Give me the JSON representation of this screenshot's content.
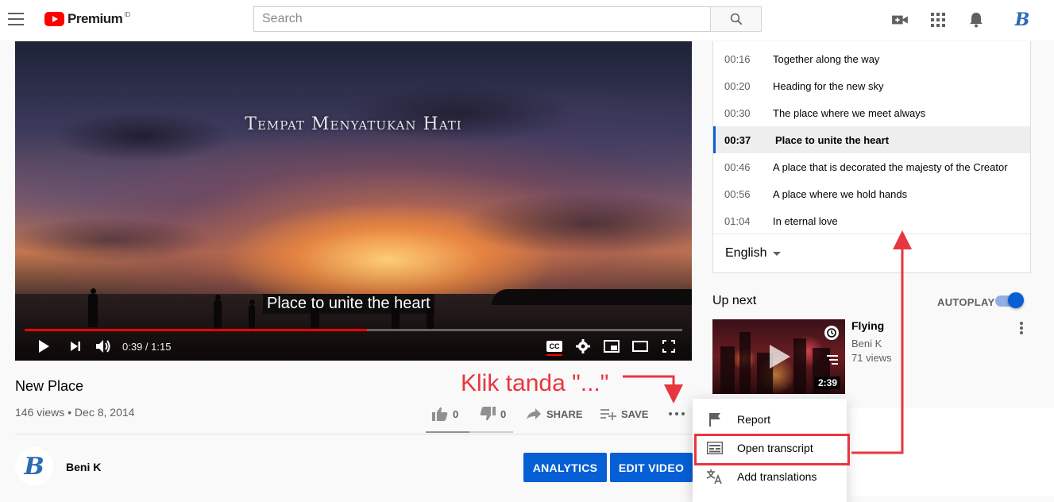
{
  "header": {
    "logo_text": "Premium",
    "logo_region": "ID",
    "search_placeholder": "Search",
    "avatar_letter": "B"
  },
  "player": {
    "overlay_title": "Tempat Menyatukan Hati",
    "caption": "Place to unite the heart",
    "time_display": "0:39 / 1:15",
    "progress_fraction": 0.52
  },
  "video": {
    "title": "New Place",
    "meta": "146 views • Dec 8, 2014",
    "likes": "0",
    "dislikes": "0",
    "share_label": "SHARE",
    "save_label": "SAVE"
  },
  "channel": {
    "name": "Beni K",
    "avatar_letter": "B",
    "analytics_label": "ANALYTICS",
    "edit_label": "EDIT VIDEO"
  },
  "transcript": {
    "rows": [
      {
        "time": "00:16",
        "text": "Together along the way"
      },
      {
        "time": "00:20",
        "text": "Heading for the new sky"
      },
      {
        "time": "00:30",
        "text": "The place where we meet always"
      },
      {
        "time": "00:37",
        "text": "Place to unite the heart"
      },
      {
        "time": "00:46",
        "text": "A place that is decorated the majesty of the Creator"
      },
      {
        "time": "00:56",
        "text": "A place where we hold hands"
      },
      {
        "time": "01:04",
        "text": "In eternal love"
      }
    ],
    "active_index": 3,
    "language": "English"
  },
  "up_next": {
    "heading": "Up next",
    "autoplay_label": "AUTOPLAY",
    "autoplay_on": true,
    "title": "Flying",
    "channel": "Beni K",
    "views": "71 views",
    "duration": "2:39"
  },
  "menu": {
    "items": [
      {
        "label": "Report",
        "icon": "flag-icon"
      },
      {
        "label": "Open transcript",
        "icon": "transcript-icon"
      },
      {
        "label": "Add translations",
        "icon": "translate-icon"
      }
    ]
  },
  "annotation": {
    "text": "Klik tanda \"...\"",
    "color": "#e8363f"
  },
  "colors": {
    "brand_red": "#ff0000",
    "accent_blue": "#065fd4",
    "annotation_red": "#e8363f"
  }
}
